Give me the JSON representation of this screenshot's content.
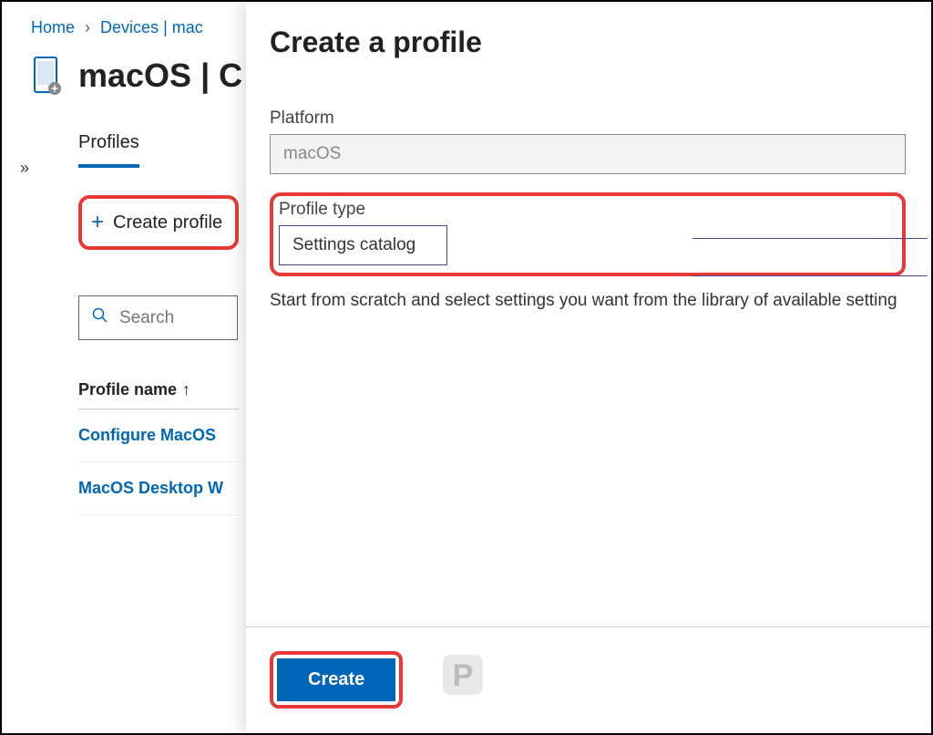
{
  "breadcrumb": {
    "home": "Home",
    "devices": "Devices | mac"
  },
  "page": {
    "title": "macOS | C"
  },
  "sidebar": {
    "tab_label": "Profiles",
    "create_profile": "Create profile",
    "search_placeholder": "Search",
    "column_header": "Profile name",
    "sort_indicator": "↑",
    "items": [
      {
        "label": "Configure MacOS"
      },
      {
        "label": "MacOS Desktop W"
      }
    ]
  },
  "flyout": {
    "title": "Create a profile",
    "platform_label": "Platform",
    "platform_value": "macOS",
    "profile_type_label": "Profile type",
    "profile_type_value": "Settings catalog",
    "helper": "Start from scratch and select settings you want from the library of available setting",
    "create_button": "Create"
  },
  "watermark": "P"
}
